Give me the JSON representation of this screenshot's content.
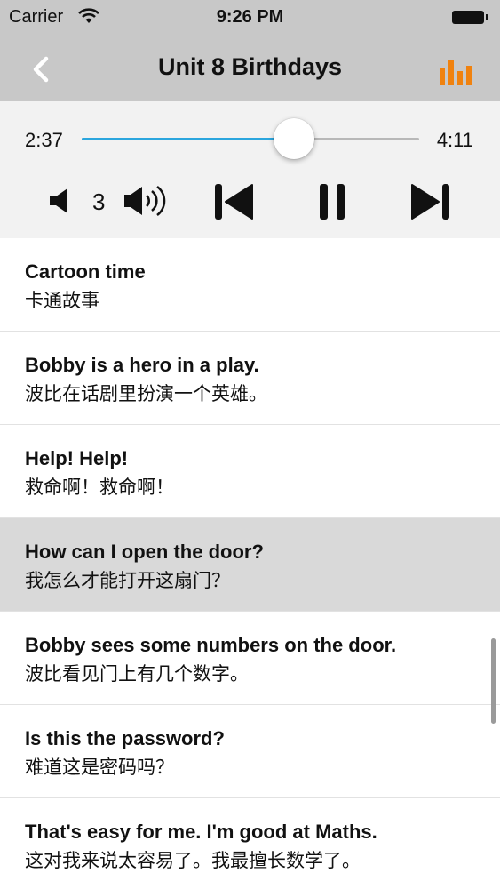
{
  "status_bar": {
    "carrier": "Carrier",
    "time": "9:26 PM"
  },
  "nav": {
    "title": "Unit 8 Birthdays",
    "back_icon": "chevron-left-icon",
    "equalizer_icon": "bar-chart-icon",
    "accent_color": "#f0820f",
    "bar_color": "#c8c8c8"
  },
  "player": {
    "elapsed": "2:37",
    "total": "4:11",
    "progress_fraction": 0.63,
    "progress_color": "#2ba6de",
    "volume": "3"
  },
  "sentences": [
    {
      "en": "Cartoon time",
      "zh": "卡通故事",
      "selected": false
    },
    {
      "en": "Bobby is a hero in a play.",
      "zh": "波比在话剧里扮演一个英雄。",
      "selected": false
    },
    {
      "en": "Help! Help!",
      "zh": "救命啊！救命啊！",
      "selected": false
    },
    {
      "en": "How can I open the door?",
      "zh": "我怎么才能打开这扇门？",
      "selected": true
    },
    {
      "en": "Bobby sees some numbers on the door.",
      "zh": "波比看见门上有几个数字。",
      "selected": false
    },
    {
      "en": "Is this the password?",
      "zh": "难道这是密码吗？",
      "selected": false
    },
    {
      "en": "That's easy for me. I'm good at Maths.",
      "zh": "这对我来说太容易了。我最擅长数学了。",
      "selected": false
    }
  ]
}
